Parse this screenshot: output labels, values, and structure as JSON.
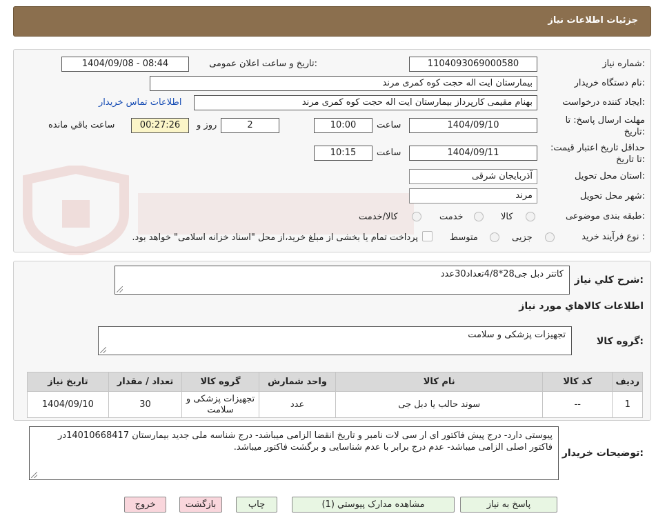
{
  "header": {
    "title": "جزئیات اطلاعات نیاز"
  },
  "form": {
    "need_number_label": "شماره نیاز:",
    "need_number": "1104093069000580",
    "announce_label": "تاریخ و ساعت اعلان عمومی:",
    "announce_value": "1404/09/08 - 08:44",
    "buyer_org_label": "نام دستگاه خریدار:",
    "buyer_org": "بیمارستان ایت اله حجت کوه کمری مرند",
    "creator_label": "ایجاد کننده درخواست:",
    "creator": "بهنام مقیمی کارپرداز بیمارستان ایت اله حجت کوه کمری مرند",
    "contact_link": "اطلاعات تماس خریدار",
    "deadline_label": "مهلت ارسال پاسخ: تا تاریخ:",
    "deadline_date": "1404/09/10",
    "time_label": "ساعت",
    "deadline_time": "10:00",
    "days_value": "2",
    "days_label": "روز و",
    "remaining_time": "00:27:26",
    "remaining_label": "ساعت باقي مانده",
    "validity_label": "حداقل تاریخ اعتبار قیمت: تا تاریخ:",
    "validity_date": "1404/09/11",
    "validity_time": "10:15",
    "province_label": "استان محل تحویل:",
    "province": "آذربایجان شرقی",
    "city_label": "شهر محل تحویل:",
    "city": "مرند",
    "category_label": "طبقه بندی موضوعی:",
    "category_options": [
      "کالا",
      "خدمت",
      "کالا/خدمت"
    ],
    "process_label": "نوع فرآیند خرید :",
    "process_options": [
      "جزیی",
      "متوسط"
    ],
    "process_note": "پرداخت تمام یا بخشی از مبلغ خرید،از محل \"اسناد خزانه اسلامی\" خواهد بود."
  },
  "summary": {
    "label": "شرح کلي نياز:",
    "value": "کاتتر دبل جی28*4/8تعداد30عدد",
    "items_title": "اطلاعات کالاهاي مورد نياز",
    "group_label": "گروه کالا:",
    "group_value": "تجهیزات پزشکی و سلامت"
  },
  "table": {
    "headers": [
      "رديف",
      "کد کالا",
      "نام کالا",
      "واحد شمارش",
      "گروه کالا",
      "تعداد / مقدار",
      "تاریخ نیاز"
    ],
    "rows": [
      [
        "1",
        "--",
        "سوند حالب یا دبل جی",
        "عدد",
        "تجهیزات پزشکی و سلامت",
        "30",
        "1404/09/10"
      ]
    ]
  },
  "notes": {
    "label": "توضیحات خریدار:",
    "value": "پیوستی دارد- درج پیش فاکتور ای ار سی لات نامبر و تاریخ انقضا الزامی میباشد- درج شناسه ملی  جدید بیمارستان 14010668417در فاکتور اصلی الزامی میباشد- عدم درج برابر با عدم شناسایی و برگشت فاکتور میباشد."
  },
  "buttons": {
    "reply": "پاسخ به نياز",
    "attachments": "مشاهده مدارک پيوستي (1)",
    "print": "چاپ",
    "back": "بازگشت",
    "exit": "خروج"
  },
  "colors": {
    "header_bg": "#8b6f4e",
    "button_green": "#e8f6e3",
    "button_pink": "#f9d6dc",
    "timer_bg": "#fbf5c8",
    "link": "#1a4fb5"
  }
}
